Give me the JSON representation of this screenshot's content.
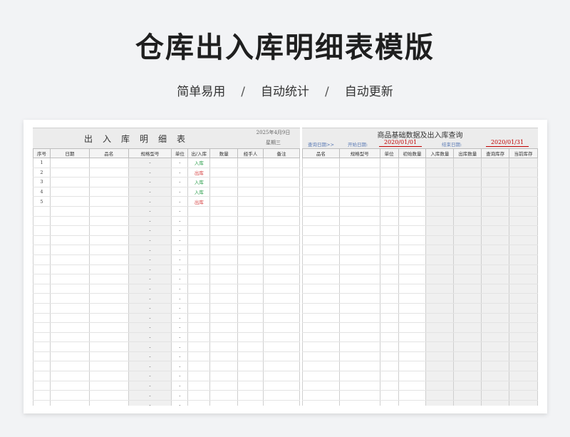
{
  "page": {
    "title": "仓库出入库明细表模版",
    "subtitle": [
      "简单易用",
      "自动统计",
      "自动更新"
    ],
    "separator": "/"
  },
  "left": {
    "title": "出入库明细表",
    "date": "2025年4月9日",
    "weekday": "星期三",
    "columns": [
      "序号",
      "日期",
      "品名",
      "规格型号",
      "单位",
      "出/入库",
      "数量",
      "经手人",
      "备注"
    ],
    "rows": [
      {
        "no": "1",
        "dir": "入库",
        "type": "in"
      },
      {
        "no": "2",
        "dir": "出库",
        "type": "out"
      },
      {
        "no": "3",
        "dir": "入库",
        "type": "in"
      },
      {
        "no": "4",
        "dir": "入库",
        "type": "in"
      },
      {
        "no": "5",
        "dir": "出库",
        "type": "out"
      }
    ],
    "dash": "-"
  },
  "right": {
    "title": "商品基础数据及出入库查询",
    "query_label": "查询日期>>",
    "start_label": "开始日期:",
    "start_value": "2020/01/01",
    "end_label": "结束日期:",
    "end_value": "2020/01/31",
    "columns": [
      "品名",
      "规格型号",
      "单位",
      "初始数量",
      "入库数量",
      "出库数量",
      "查询库存",
      "当前库存"
    ]
  }
}
